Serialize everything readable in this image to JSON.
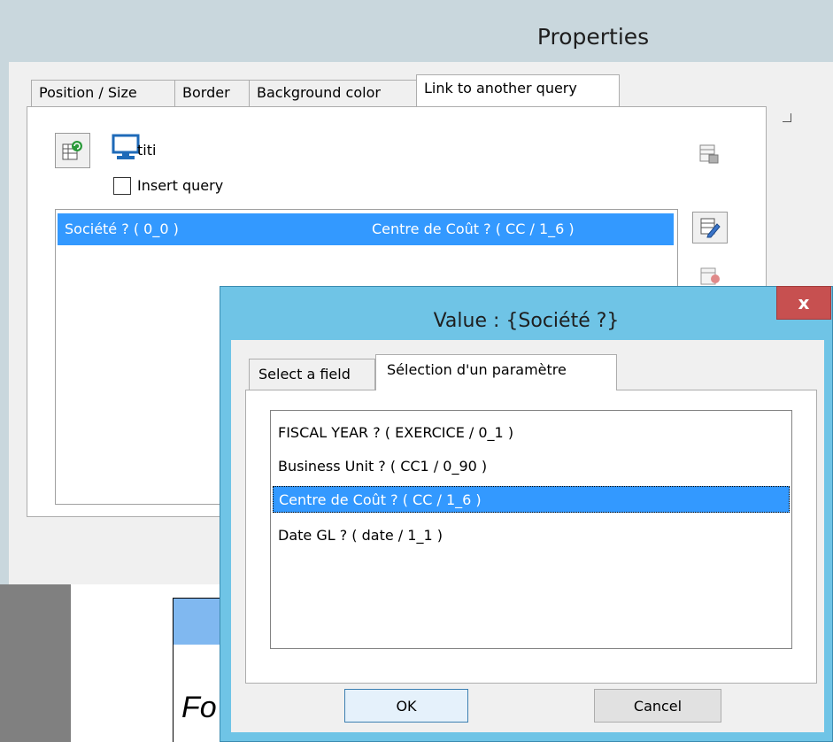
{
  "properties_window": {
    "title": "Properties",
    "tabs": [
      {
        "label": "Position / Size"
      },
      {
        "label": "Border"
      },
      {
        "label": "Background color"
      },
      {
        "label": "Link to another query"
      }
    ],
    "active_tab": "Link to another query",
    "query_name": "titi",
    "insert_query_label": "Insert query",
    "insert_query_checked": false,
    "link_row": {
      "left": "Société ? ( 0_0 )",
      "right": "Centre de Coût ? ( CC / 1_6 )"
    }
  },
  "background": {
    "partial_text": "Fo"
  },
  "value_dialog": {
    "title": "Value : {Société ?}",
    "close_label": "x",
    "tabs": [
      {
        "label": "Select a field"
      },
      {
        "label": "Sélection d'un paramètre"
      }
    ],
    "active_tab": "Sélection d'un paramètre",
    "parameters": [
      {
        "label": "FISCAL YEAR ? ( EXERCICE / 0_1 )",
        "selected": false
      },
      {
        "label": "Business Unit ? ( CC1 / 0_90 )",
        "selected": false
      },
      {
        "label": "Centre de Coût ? ( CC / 1_6 )",
        "selected": true
      },
      {
        "label": "Date GL ? ( date / 1_1 )",
        "selected": false
      }
    ],
    "ok_label": "OK",
    "cancel_label": "Cancel"
  },
  "colors": {
    "selection": "#3399ff",
    "dialog_frame": "#6fc4e6",
    "close_button": "#c75050"
  }
}
